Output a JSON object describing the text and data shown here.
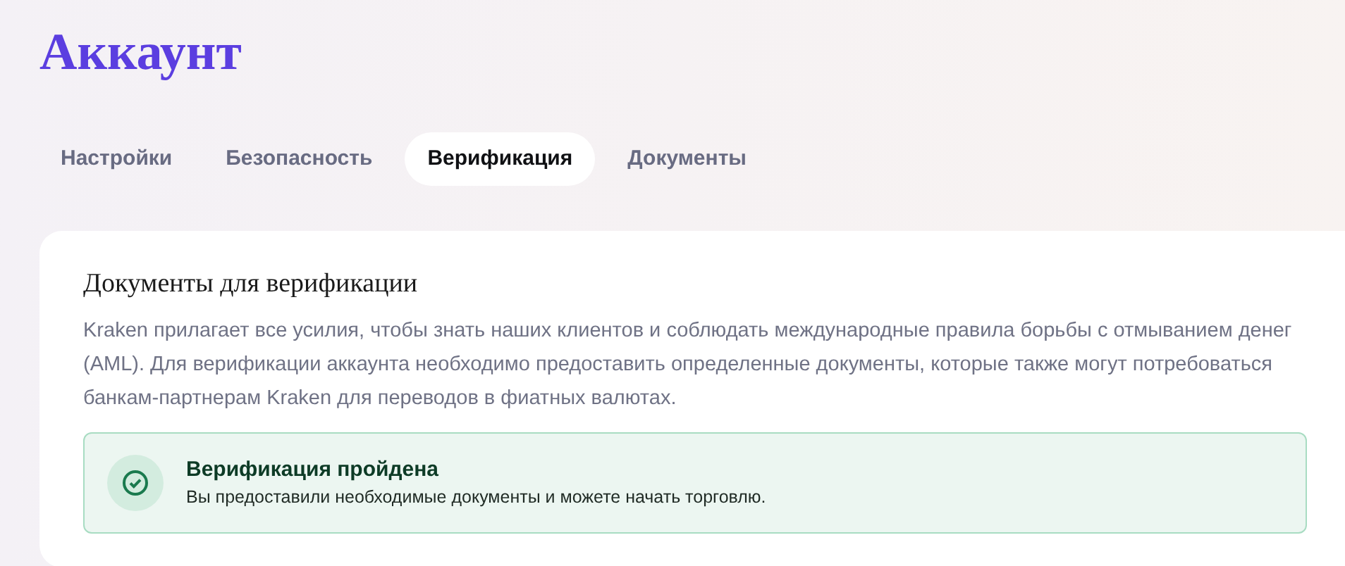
{
  "title": "Аккаунт",
  "tabs": [
    {
      "label": "Настройки",
      "selected": false
    },
    {
      "label": "Безопасность",
      "selected": false
    },
    {
      "label": "Верификация",
      "selected": true
    },
    {
      "label": "Документы",
      "selected": false
    }
  ],
  "card": {
    "heading": "Документы для верификации",
    "description": "Kraken прилагает все усилия, чтобы знать наших клиентов и соблюдать международные правила борьбы с отмыванием денег (AML). Для верификации аккаунта необходимо предоставить определенные документы, которые также могут потребоваться банкам-партнерам Kraken для переводов в фиатных валютах.",
    "status": {
      "title": "Верификация пройдена",
      "message": "Вы предоставили необходимые документы и можете начать торговлю."
    }
  }
}
